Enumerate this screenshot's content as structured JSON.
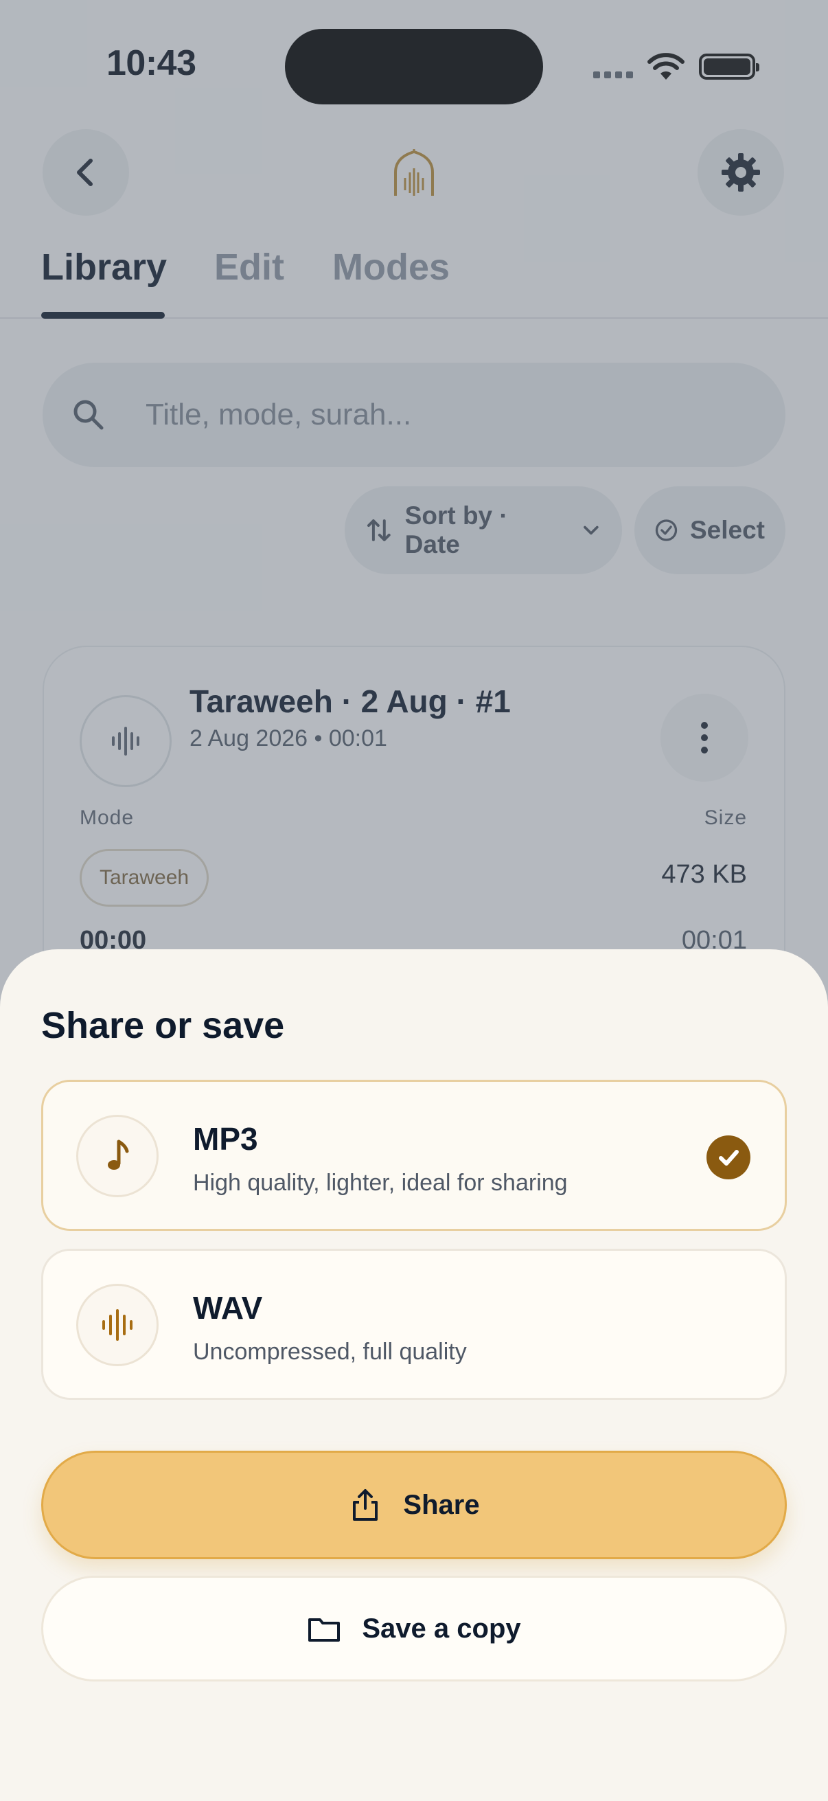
{
  "status_bar": {
    "time": "10:43"
  },
  "header": {
    "back_icon": "chevron-left-icon",
    "logo_icon": "mosque-arch-icon",
    "settings_icon": "gear-icon"
  },
  "tabs": [
    {
      "label": "Library",
      "active": true
    },
    {
      "label": "Edit",
      "active": false
    },
    {
      "label": "Modes",
      "active": false
    }
  ],
  "search": {
    "placeholder": "Title, mode, surah..."
  },
  "toolbar": {
    "sort_label": "Sort by · Date",
    "select_label": "Select"
  },
  "recording_card": {
    "title": "Taraweeh · 2 Aug · #1",
    "subtitle": "2 Aug 2026 • 00:01",
    "mode_label": "Mode",
    "size_label": "Size",
    "mode_value": "Taraweeh",
    "size_value": "473 KB",
    "time_current": "00:00",
    "time_total": "00:01"
  },
  "sheet": {
    "title": "Share or save",
    "options": [
      {
        "title": "MP3",
        "description": "High quality, lighter, ideal for sharing",
        "icon": "music-note-icon",
        "selected": true
      },
      {
        "title": "WAV",
        "description": "Uncompressed, full quality",
        "icon": "waveform-icon",
        "selected": false
      }
    ],
    "share_label": "Share",
    "save_label": "Save a copy"
  },
  "colors": {
    "accent": "#F2C679",
    "accent_dark": "#8A5A10",
    "text": "#0F1B2D",
    "sheet_bg": "#F8F5EF"
  }
}
